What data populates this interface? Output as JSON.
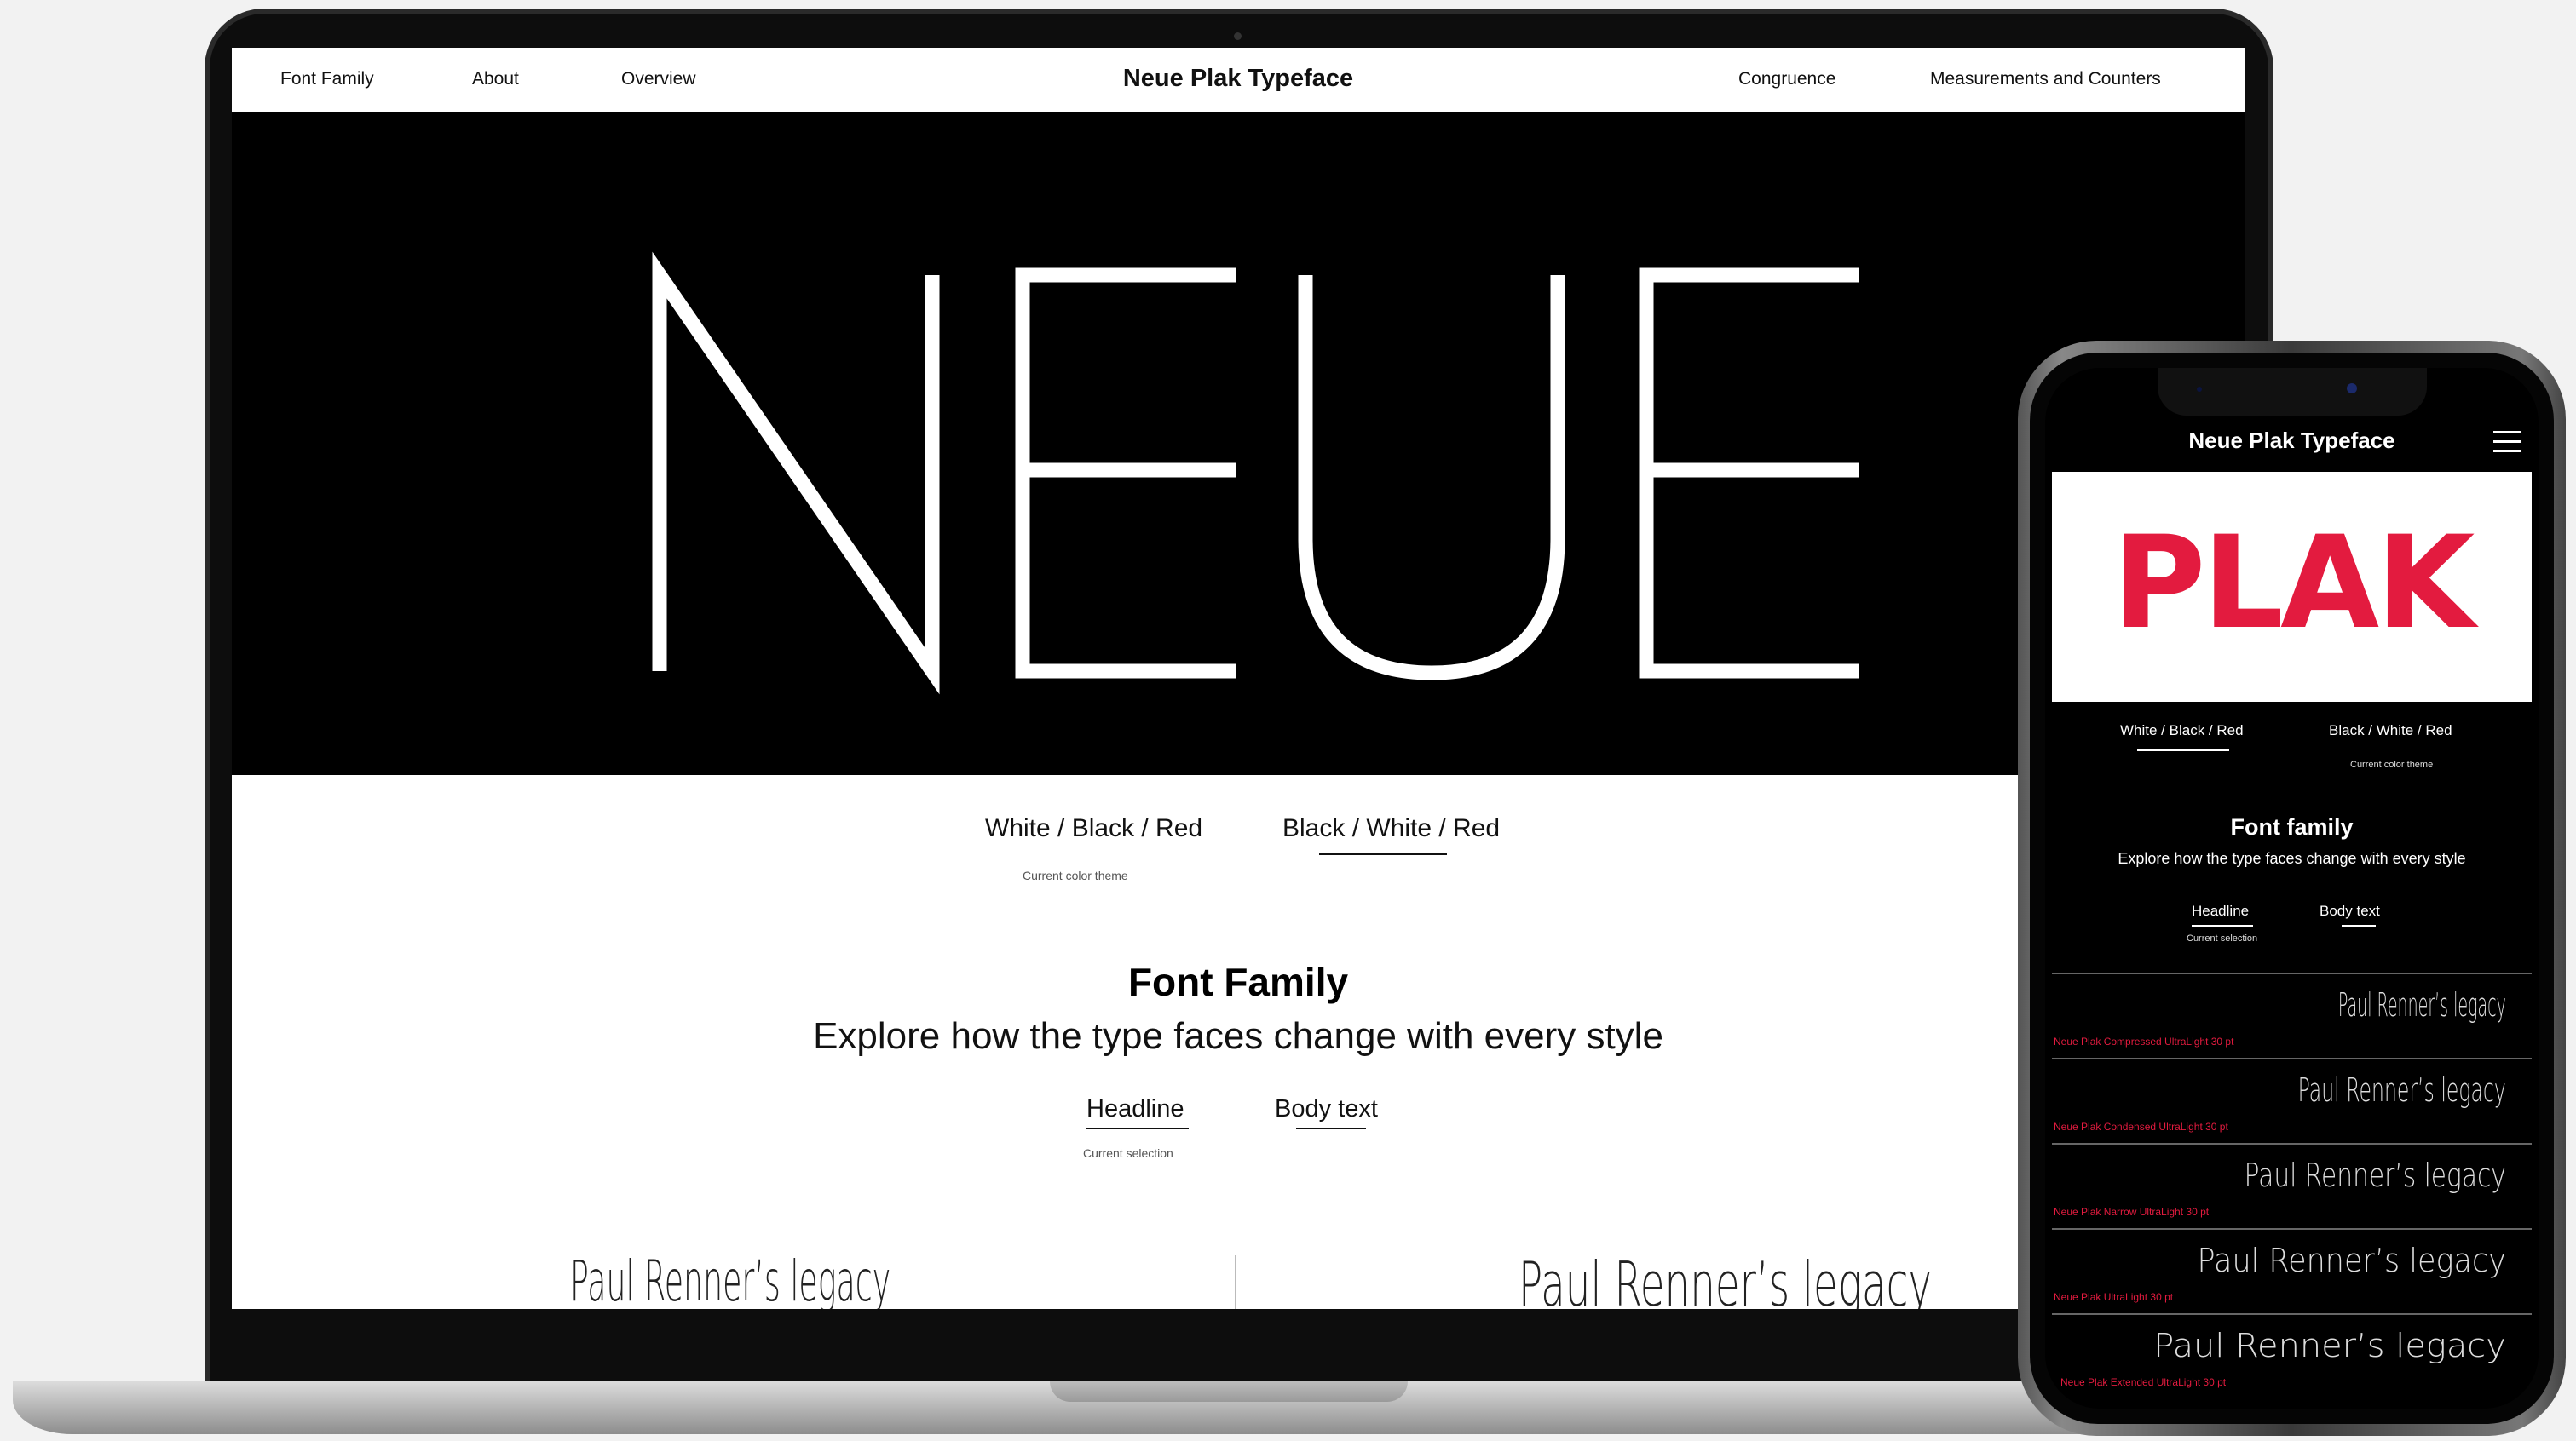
{
  "laptop": {
    "nav": {
      "left_items": [
        "Font Family",
        "About",
        "Overview"
      ],
      "title": "Neue Plak Typeface",
      "right_items": [
        "Congruence",
        "Measurements and Counters"
      ]
    },
    "hero_word": "NEUE",
    "theme": {
      "options": [
        "White / Black / Red",
        "Black / White / Red"
      ],
      "caption": "Current color theme"
    },
    "font_family": {
      "title": "Font Family",
      "subtitle": "Explore how the type faces change with every style",
      "options": [
        "Headline",
        "Body text"
      ],
      "caption": "Current selection"
    },
    "samples": [
      "Paul Renner’s legacy",
      "Paul Renner’s legacy"
    ]
  },
  "phone": {
    "title": "Neue Plak Typeface",
    "hero_word": "PLAK",
    "theme": {
      "options": [
        "White / Black / Red",
        "Black / White / Red"
      ],
      "caption": "Current color theme"
    },
    "font_family": {
      "title": "Font family",
      "subtitle": "Explore how the type faces change with every style",
      "options": [
        "Headline",
        "Body text"
      ],
      "caption": "Current selection"
    },
    "rows": [
      {
        "sample": "Paul Renner’s legacy",
        "caption": "Neue Plak Compressed UltraLight 30 pt"
      },
      {
        "sample": "Paul Renner’s legacy",
        "caption": "Neue Plak Condensed UltraLight 30 pt"
      },
      {
        "sample": "Paul Renner’s legacy",
        "caption": "Neue Plak Narrow UltraLight 30 pt"
      },
      {
        "sample": "Paul Renner’s legacy",
        "caption": "Neue Plak UltraLight 30 pt"
      },
      {
        "sample": "Paul Renner’s legacy",
        "caption": "Neue Plak Extended UltraLight 30 pt"
      }
    ]
  },
  "colors": {
    "accent_red": "#e31b3f",
    "background": "#f2f2f2",
    "dark": "#000000",
    "light": "#ffffff"
  }
}
